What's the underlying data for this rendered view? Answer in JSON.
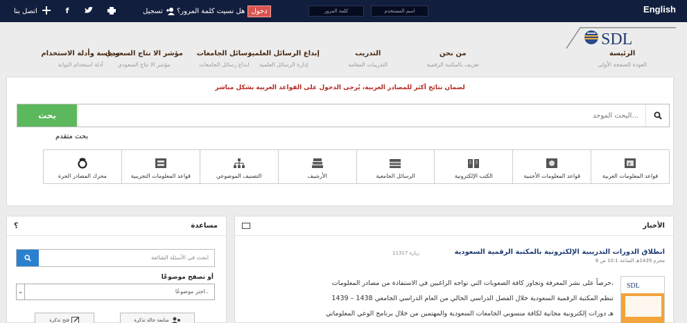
{
  "topbar": {
    "language": "English",
    "username_placeholder": "اسم المستخدم",
    "password_placeholder": "كلمة المرور",
    "login_label": "دخول",
    "forgot_password": "هل نسيت كلمة المرور؟",
    "register_label": "تسجيل",
    "contact_label": "اتصل بنا"
  },
  "logo": {
    "text": "SDL"
  },
  "nav": [
    {
      "label": "الرئيسة",
      "sub": "العودة للصفحة الأولى"
    },
    {
      "label": "من نحن",
      "sub": "تعريف بالمكتبة الرقمية"
    },
    {
      "label": "التدريب",
      "sub": "التدريبات المقامة"
    },
    {
      "label": "إبداع الرسائل العلمية",
      "sub": "إدارة الرسائل العلمية"
    },
    {
      "label": "رسائل الجامعات",
      "sub": "ابداع رسائل الجامعات"
    },
    {
      "label": "مؤشر الا نتاج السعودي",
      "sub": "مؤشر الا نتاج السعودي"
    },
    {
      "label": "سياسة وأدلة الاستخدام",
      "sub": "أدلة استخدام البوابة"
    }
  ],
  "search": {
    "notice": "لضمان نتائج أكثر للمصادر العربية، يُرجى الدخول على القواعد العربية بشكل مباشر",
    "placeholder": "البحث الموحد...",
    "button_label": "بحث",
    "advanced_label": "بحث متقدم"
  },
  "categories": [
    {
      "label": "قواعد المعلومات العربية",
      "icon": "arabic-db-icon"
    },
    {
      "label": "قواعد المعلومات الأجنبية",
      "icon": "foreign-db-icon"
    },
    {
      "label": "الكتب الإلكترونية",
      "icon": "ebook-icon"
    },
    {
      "label": "الرسائل الجامعية",
      "icon": "thesis-icon"
    },
    {
      "label": "الأرشيف",
      "icon": "archive-icon"
    },
    {
      "label": "التصنيف الموضوعي",
      "icon": "classification-icon"
    },
    {
      "label": "قواعد المعلومات التجريبية",
      "icon": "trial-db-icon"
    },
    {
      "label": "محرك المصادر الحرة",
      "icon": "open-source-icon"
    }
  ],
  "help": {
    "title": "مساعدة",
    "icon_text": "؟",
    "search_placeholder": "ابحث في الأسئلة الشائعة",
    "browse_label": "أو تصفح موضوعًا",
    "select_value": "اختر موضوعًا..",
    "track_ticket": "متابعة حالة تذكرة",
    "open_ticket": "فتح تذكرة"
  },
  "news": {
    "title": "الأخبار",
    "headline": "انطلاق الدورات التدريبية الإلكترونية بالمكتبة الرقمية السعودية",
    "views": "11317 زيارة",
    "date": "8 محرم 1439هـ الساعة 10:1 ص",
    "lines": [
      "حرصاً على نشر المعرفة وتجاوز كافة الصعوبات التي تواجه الراغبين في الاستفادة من مصادر المعلومات،",
      "تنظم المكتبة الرقمية السعودية خلال الفصل الدراسي الحالي من العام الدراسي الجامعي 1438 – 1439",
      "هـ دورات إلكترونية مجانية لكافة منسوبي الجامعات السعودية والمهتمين من خلال برنامج الوعي المعلوماتي"
    ],
    "image_logo": "SDL"
  }
}
